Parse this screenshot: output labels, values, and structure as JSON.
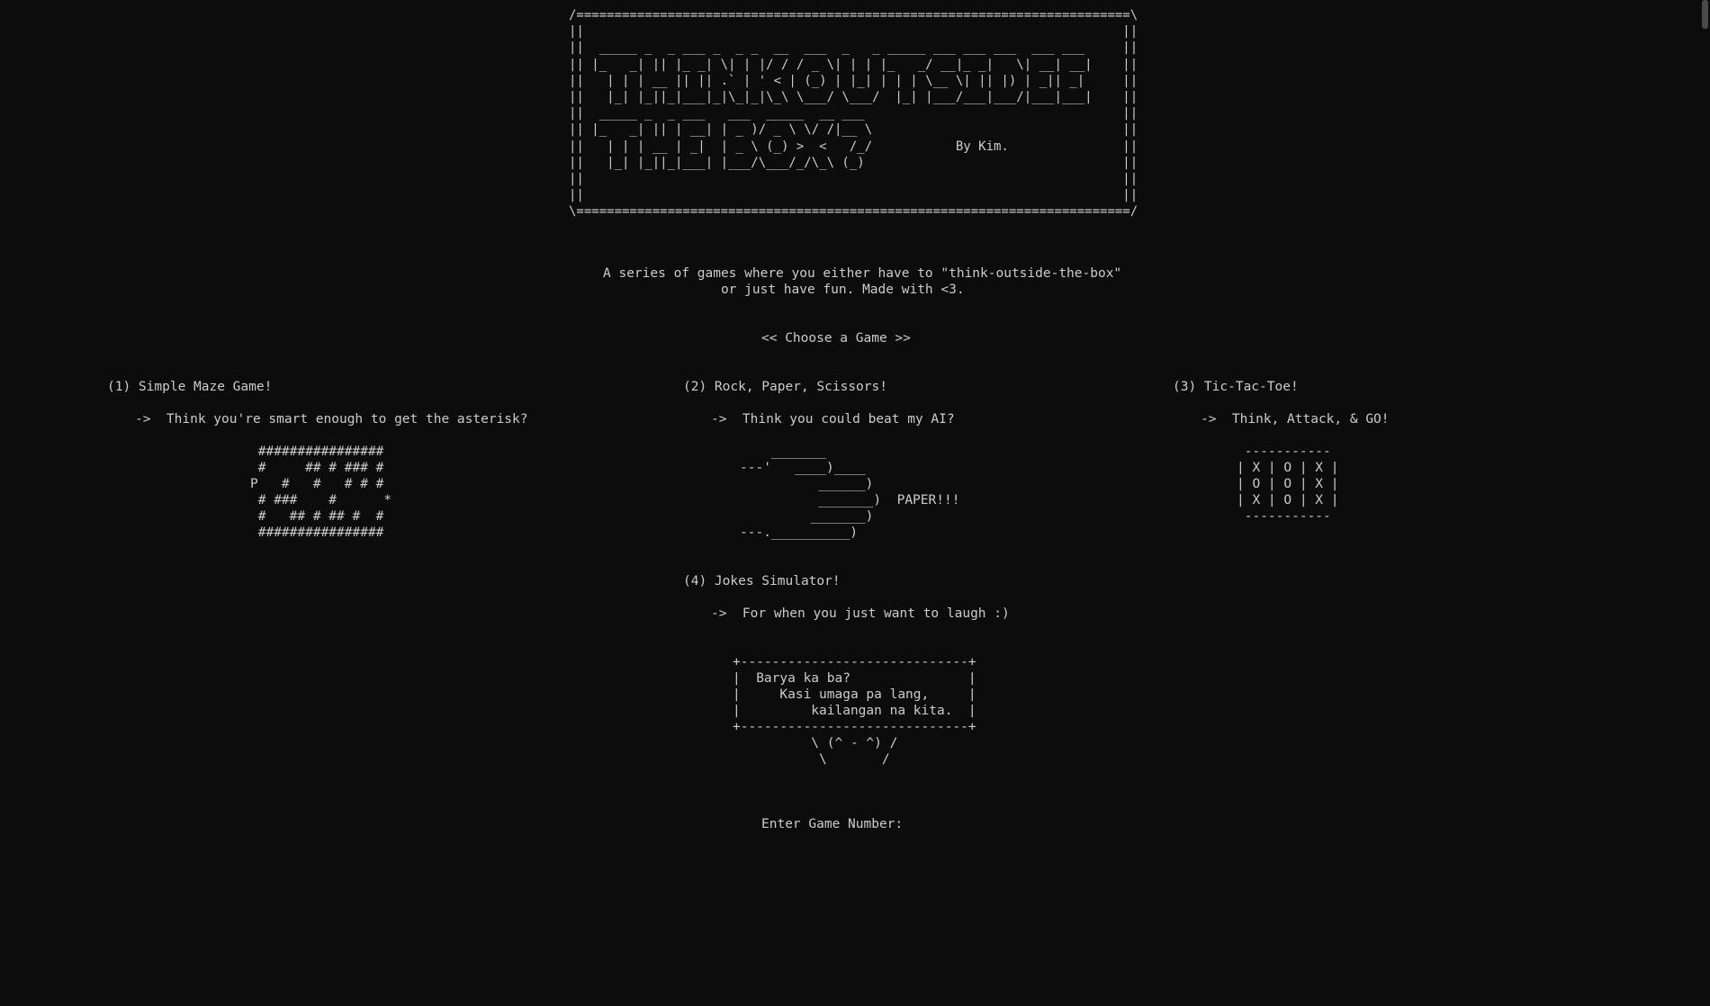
{
  "banner": {
    "art": "/=========================================================================\\\n||                                                                       ||\n||  _____ _  _ ___ _  _ _  __  ___  _   _ _____ ___ ___ ___  ___ ___     ||\n|| |_   _| || |_ _| \\| | |/ / / _ \\| | | |_   _/ __|_ _|   \\| __| __|    ||\n||   | | | __ || || .` | ' < | (_) | |_| | | | \\__ \\| || |) | _|| _|     ||\n||   |_| |_||_|___|_|\\_|_|\\_\\ \\___/ \\___/  |_| |___/___|___/|___|___|    ||\n||  _____ _  _ ___   ___  _____  __ ___                                  ||\n|| |_   _| || | __| | _ )/ _ \\ \\/ /|__ \\                                 ||\n||   | | | __ | _|  | _ \\ (_) >  <   /_/           By Kim.               ||\n||   |_| |_||_|___| |___/\\___/_/\\_\\ (_)                                  ||\n||                                                                       ||\n||                                                                       ||\n\\=========================================================================/"
  },
  "tagline": "A series of games where you either have to \"think-outside-the-box\"\n               or just have fun. Made with <3.",
  "choose_label": "<< Choose a Game >>",
  "games": [
    {
      "title": "(1) Simple Maze Game!",
      "desc": "->  Think you're smart enough to get the asterisk?",
      "art": " ################\n #     ## # ### #\nP   #   #   # # #\n # ###    #      *\n #   ## # ## #  #\n ################"
    },
    {
      "title": "(2) Rock, Paper, Scissors!",
      "desc": "->  Think you could beat my AI?",
      "art": "    _______\n---'   ____)____\n          ______)\n          _______)  PAPER!!!\n         _______)\n---.__________)"
    },
    {
      "title": "(3) Tic-Tac-Toe!",
      "desc": "->  Think, Attack, & GO!",
      "art": " -----------\n| X | O | X |\n| O | O | X |\n| X | O | X |\n -----------"
    },
    {
      "title": "(4) Jokes Simulator!",
      "desc": "->  For when you just want to laugh :)",
      "art": "+-----------------------------+\n|  Barya ka ba?               |\n|     Kasi umaga pa lang,     |\n|         kailangan na kita.  |\n+-----------------------------+\n          \\ (^ - ^) /\n           \\       /"
    }
  ],
  "prompt": "Enter Game Number:"
}
